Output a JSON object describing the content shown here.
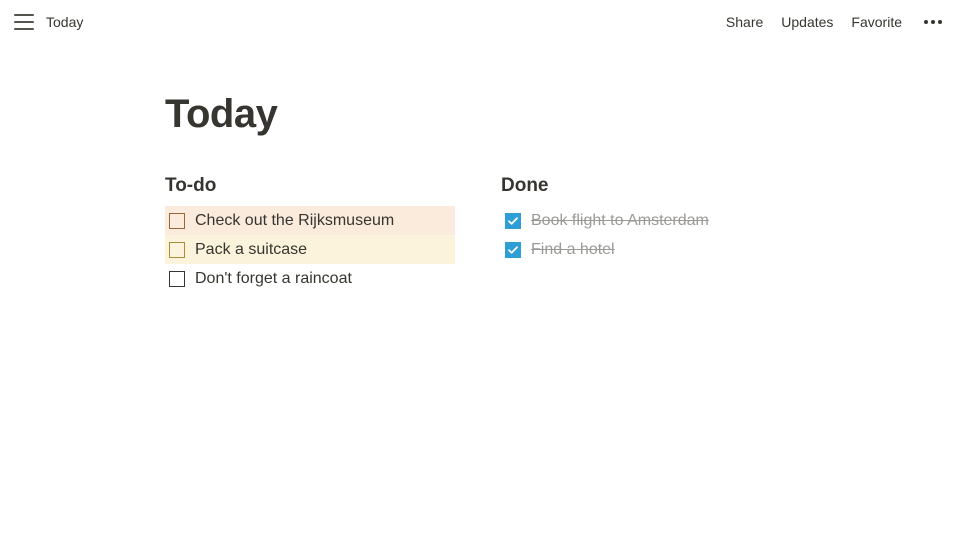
{
  "topbar": {
    "breadcrumb": "Today",
    "actions": {
      "share": "Share",
      "updates": "Updates",
      "favorite": "Favorite"
    }
  },
  "page": {
    "title": "Today"
  },
  "columns": {
    "todo": {
      "heading": "To-do",
      "items": [
        {
          "label": "Check out the Rijksmuseum",
          "checked": false,
          "highlight": "orange"
        },
        {
          "label": "Pack a suitcase",
          "checked": false,
          "highlight": "yellow"
        },
        {
          "label": "Don't forget a raincoat",
          "checked": false,
          "highlight": "none"
        }
      ]
    },
    "done": {
      "heading": "Done",
      "items": [
        {
          "label": "Book flight to Amsterdam",
          "checked": true
        },
        {
          "label": "Find a hotel",
          "checked": true
        }
      ]
    }
  }
}
